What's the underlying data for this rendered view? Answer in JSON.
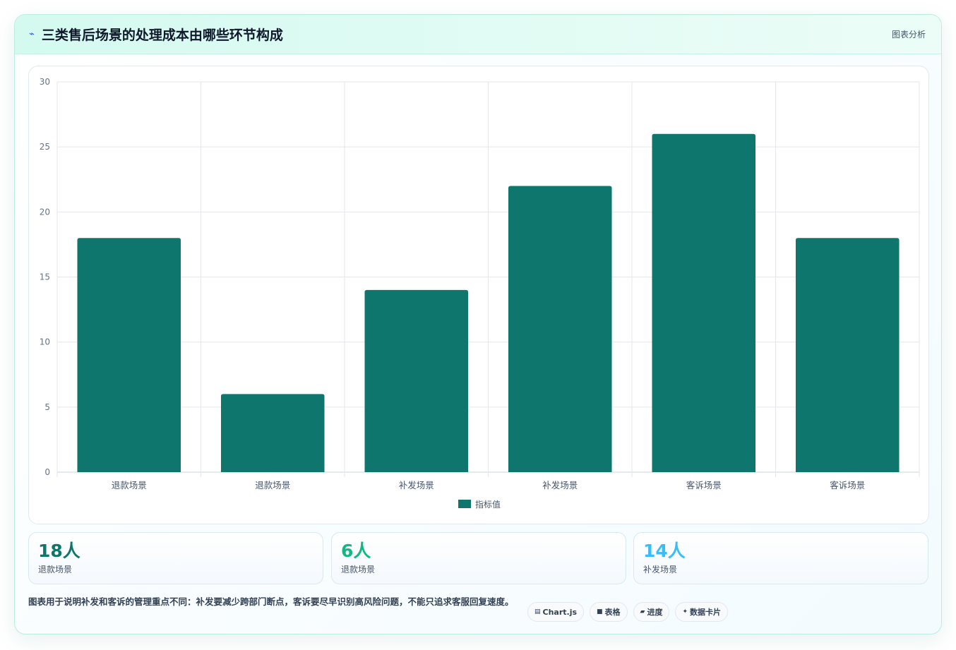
{
  "header": {
    "icon": "chart-spark-icon",
    "title": "三类售后场景的处理成本由哪些环节构成",
    "tag": "图表分析"
  },
  "colors": {
    "bar": "#0f766e",
    "stat1": "#0f766e",
    "stat2": "#10b981",
    "stat3": "#38bdf8"
  },
  "chart_data": {
    "type": "bar",
    "categories": [
      "退款场景",
      "退款场景",
      "补发场景",
      "补发场景",
      "客诉场景",
      "客诉场景"
    ],
    "series": [
      {
        "name": "指标值",
        "values": [
          18,
          6,
          14,
          22,
          26,
          18
        ]
      }
    ],
    "ylim": [
      0,
      30
    ],
    "yticks": [
      0,
      5,
      10,
      15,
      20,
      25,
      30
    ],
    "grid": true,
    "legend": "bottom"
  },
  "stats": [
    {
      "value": "18人",
      "label": "退款场景"
    },
    {
      "value": "6人",
      "label": "退款场景"
    },
    {
      "value": "14人",
      "label": "补发场景"
    }
  ],
  "footer": {
    "note": "图表用于说明补发和客诉的管理重点不同：补发要减少跨部门断点，客诉要尽早识别高风险问题，不能只追求客服回复速度。",
    "pills": [
      {
        "icon": "chart-icon",
        "glyph": "▤",
        "label": "Chart.js"
      },
      {
        "icon": "table-icon",
        "glyph": "■",
        "label": "表格"
      },
      {
        "icon": "progress-icon",
        "glyph": "▰",
        "label": "进度"
      },
      {
        "icon": "sparkle-icon",
        "glyph": "✦",
        "label": "数据卡片"
      }
    ]
  }
}
